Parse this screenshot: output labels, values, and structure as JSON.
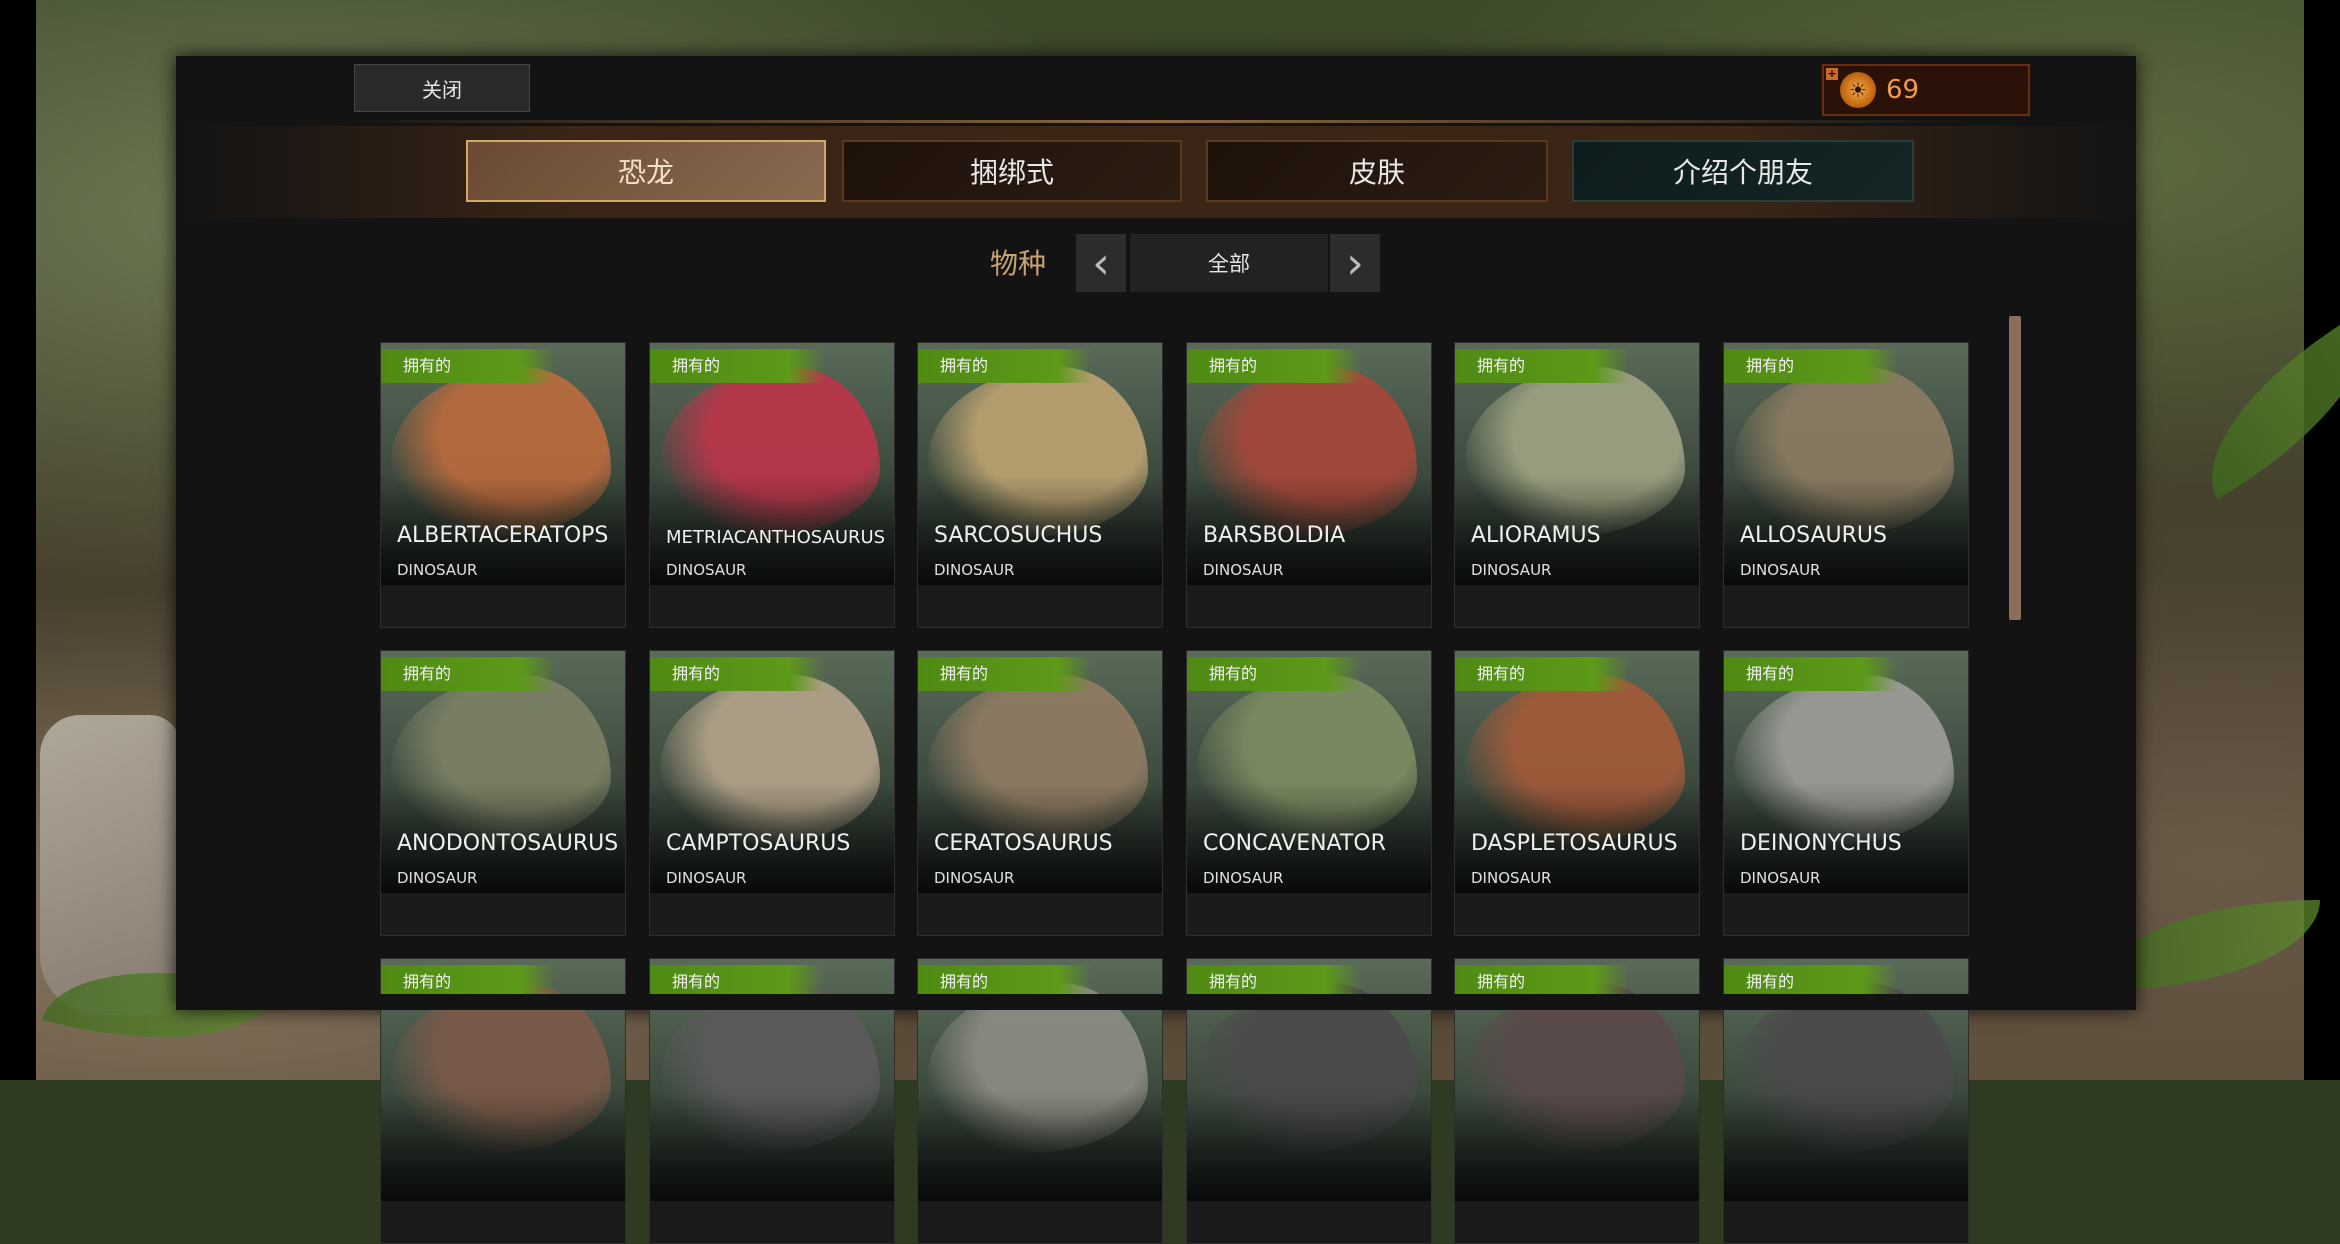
{
  "header": {
    "close_label": "关闭",
    "currency_value": "69",
    "currency_icon": "wolf-emblem-icon"
  },
  "tabs": [
    {
      "label": "恐龙",
      "active": true
    },
    {
      "label": "捆绑式",
      "active": false
    },
    {
      "label": "皮肤",
      "active": false
    },
    {
      "label": "介绍个朋友",
      "active": false
    }
  ],
  "filter": {
    "label": "物种",
    "value": "全部",
    "prev_icon": "chevron-left-icon",
    "next_icon": "chevron-right-icon"
  },
  "cards": [
    {
      "badge": "拥有的",
      "name": "ALBERTACERATOPS",
      "type": "DINOSAUR",
      "color": "#b86a3e"
    },
    {
      "badge": "拥有的",
      "name": "METRIACANTHOSAURUS",
      "type": "DINOSAUR",
      "color": "#b8364a"
    },
    {
      "badge": "拥有的",
      "name": "SARCOSUCHUS",
      "type": "DINOSAUR",
      "color": "#b8a070"
    },
    {
      "badge": "拥有的",
      "name": "BARSBOLDIA",
      "type": "DINOSAUR",
      "color": "#a4483a"
    },
    {
      "badge": "拥有的",
      "name": "ALIORAMUS",
      "type": "DINOSAUR",
      "color": "#9aa080"
    },
    {
      "badge": "拥有的",
      "name": "ALLOSAURUS",
      "type": "DINOSAUR",
      "color": "#8a7a62"
    },
    {
      "badge": "拥有的",
      "name": "ANODONTOSAURUS",
      "type": "DINOSAUR",
      "color": "#7a8064"
    },
    {
      "badge": "拥有的",
      "name": "CAMPTOSAURUS",
      "type": "DINOSAUR",
      "color": "#b0a088"
    },
    {
      "badge": "拥有的",
      "name": "CERATOSAURUS",
      "type": "DINOSAUR",
      "color": "#8e7a62"
    },
    {
      "badge": "拥有的",
      "name": "CONCAVENATOR",
      "type": "DINOSAUR",
      "color": "#7a8a62"
    },
    {
      "badge": "拥有的",
      "name": "DASPLETOSAURUS",
      "type": "DINOSAUR",
      "color": "#a05a3a"
    },
    {
      "badge": "拥有的",
      "name": "DEINONYCHUS",
      "type": "DINOSAUR",
      "color": "#9a9a96"
    },
    {
      "badge": "拥有的",
      "name": "",
      "type": "",
      "color": "#7a5a4a"
    },
    {
      "badge": "拥有的",
      "name": "",
      "type": "",
      "color": "#5a5a5a"
    },
    {
      "badge": "拥有的",
      "name": "",
      "type": "",
      "color": "#8a8a80"
    },
    {
      "badge": "拥有的",
      "name": "",
      "type": "",
      "color": "#4a4a4a"
    },
    {
      "badge": "拥有的",
      "name": "",
      "type": "",
      "color": "#5a4a4a"
    },
    {
      "badge": "拥有的",
      "name": "",
      "type": "",
      "color": "#4a4a4a"
    }
  ]
}
